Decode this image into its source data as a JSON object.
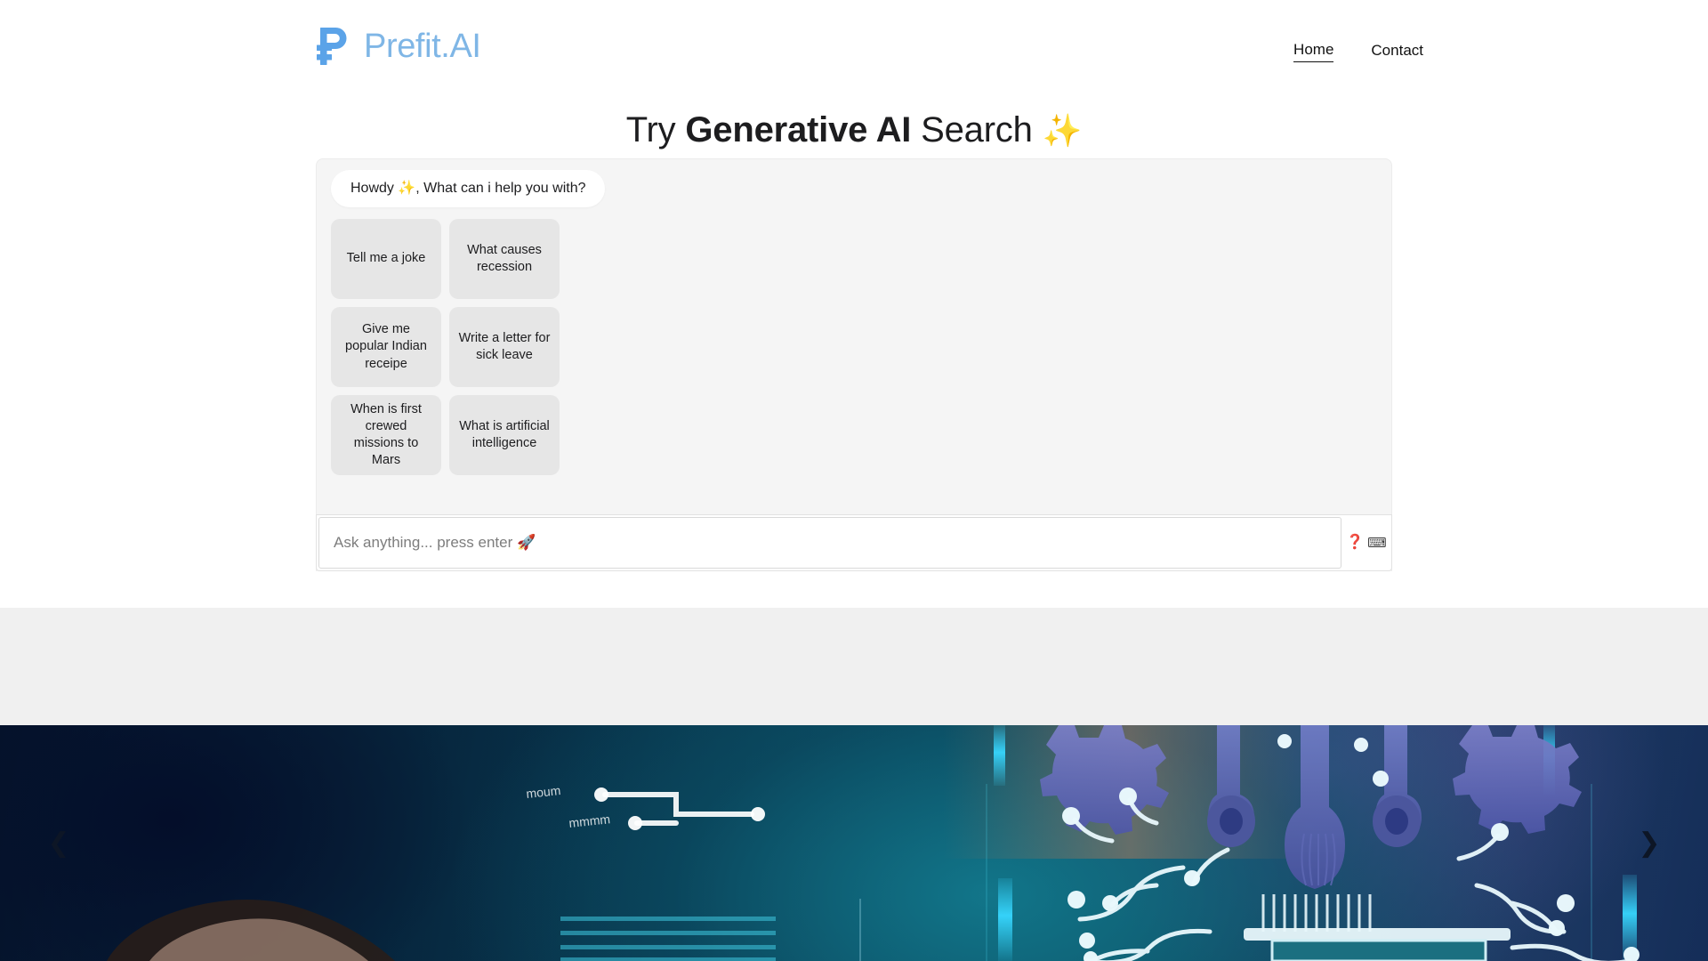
{
  "header": {
    "brand": {
      "mark_icon": "ruble-p-logo-icon",
      "name": "Prefit.AI",
      "mark_color": "#5ba3e8",
      "text_color": "#7fb6e6"
    },
    "nav": [
      {
        "label": "Home",
        "active": true
      },
      {
        "label": "Contact",
        "active": false
      }
    ]
  },
  "hero": {
    "title_prefix": "Try ",
    "title_strong": "Generative AI",
    "title_suffix": " Search ",
    "title_sparkle": "✨"
  },
  "chat": {
    "greeting": "Howdy ✨, What can i help you with?",
    "suggestions": [
      "Tell me a joke",
      "What causes recession",
      "Give me popular Indian receipe",
      "Write a letter for sick leave",
      "When is first crewed missions to Mars",
      "What is artificial intelligence"
    ],
    "composer": {
      "value": "",
      "placeholder": "Ask anything... press enter 🚀",
      "help_icon": "question-mark-icon",
      "help_glyph": "❓",
      "keyboard_icon": "keyboard-icon",
      "keyboard_glyph": "⌨",
      "help_color": "#e03a3a"
    }
  },
  "carousel": {
    "prev_icon": "chevron-left-icon",
    "prev_glyph": "❮",
    "next_icon": "chevron-right-icon",
    "next_glyph": "❯",
    "slide_alt": "AI circuit board hero image",
    "accent_color": "#11707f"
  }
}
